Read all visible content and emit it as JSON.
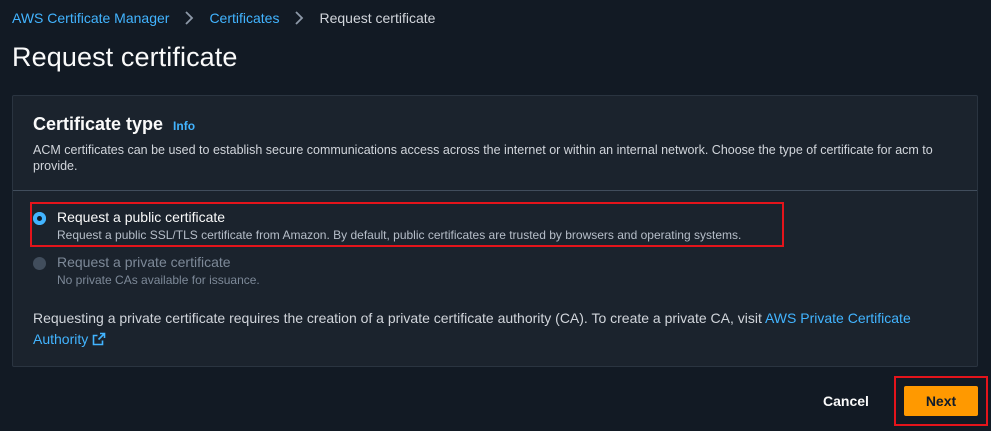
{
  "breadcrumb": {
    "items": [
      "AWS Certificate Manager",
      "Certificates"
    ],
    "current": "Request certificate"
  },
  "page_title": "Request certificate",
  "card": {
    "title": "Certificate type",
    "info": "Info",
    "description": "ACM certificates can be used to establish secure communications access across the internet or within an internal network. Choose the type of certificate for acm to provide.",
    "options": [
      {
        "label": "Request a public certificate",
        "description": "Request a public SSL/TLS certificate from Amazon. By default, public certificates are trusted by browsers and operating systems.",
        "selected": true,
        "disabled": false
      },
      {
        "label": "Request a private certificate",
        "description": "No private CAs available for issuance.",
        "selected": false,
        "disabled": true
      }
    ],
    "note_text": "Requesting a private certificate requires the creation of a private certificate authority (CA). To create a private CA, visit ",
    "note_link": "AWS Private Certificate Authority"
  },
  "footer": {
    "cancel_label": "Cancel",
    "next_label": "Next"
  },
  "colors": {
    "accent": "#42b4ff",
    "primary_button": "#ff9900",
    "highlight": "#e4141b"
  },
  "icons": [
    "chevron-right-icon",
    "external-link-icon",
    "radio-icon"
  ]
}
